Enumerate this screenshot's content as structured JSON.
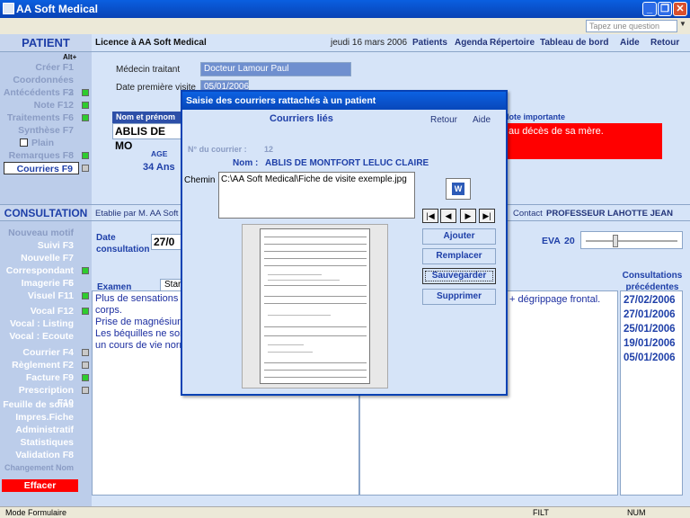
{
  "window": {
    "title": "AA Soft Medical"
  },
  "menu": {
    "question_placeholder": "Tapez une question"
  },
  "header": {
    "patient_section": "PATIENT",
    "licence": "Licence à  AA Soft Medical",
    "date": "jeudi 16 mars 2006",
    "nav": [
      "Patients",
      "Agenda",
      "Répertoire",
      "Tableau de bord",
      "Aide",
      "Retour"
    ]
  },
  "sidebar": {
    "alt_hint": "Alt+",
    "patient_items": [
      {
        "label": "Créer",
        "key": "F1",
        "state": "dis"
      },
      {
        "label": "Coordonnées",
        "key": "F2",
        "state": "dis"
      },
      {
        "label": "Antécédents",
        "key": "F3",
        "state": "dis",
        "sq": "green"
      },
      {
        "label": "Note",
        "key": "F12",
        "state": "dis",
        "sq": "green"
      },
      {
        "label": "Traitements",
        "key": "F6",
        "state": "dis",
        "sq": "green"
      },
      {
        "label": "Synthèse",
        "key": "F7",
        "state": "dis"
      },
      {
        "label": "Plain",
        "key": "",
        "state": "dis"
      },
      {
        "label": "Remarques",
        "key": "F8",
        "state": "dis",
        "sq": "green"
      },
      {
        "label": "Courriers",
        "key": "F9",
        "state": "act",
        "sq": "gray"
      }
    ],
    "consultation_section": "CONSULTATION",
    "consult_items": [
      {
        "label": "Nouveau motif",
        "key": "",
        "state": "dis"
      },
      {
        "label": "Suivi",
        "key": "F3",
        "state": "white"
      },
      {
        "label": "Nouvelle",
        "key": "F7",
        "state": "white"
      },
      {
        "label": "Correspondant",
        "key": "F5",
        "state": "white",
        "sq": "green"
      },
      {
        "label": "Imagerie",
        "key": "F6",
        "state": "white"
      },
      {
        "label": "Visuel",
        "key": "F11",
        "state": "white",
        "sq": "green"
      },
      {
        "label": "Vocal",
        "key": "F12",
        "state": "white",
        "sq": "green"
      },
      {
        "label": "Vocal : Listing",
        "key": "",
        "state": "white"
      },
      {
        "label": "Vocal : Ecoute",
        "key": "",
        "state": "white"
      },
      {
        "label": "Courrier",
        "key": "F4",
        "state": "white",
        "sq": "gray"
      },
      {
        "label": "Règlement",
        "key": "F2",
        "state": "white",
        "sq": "gray"
      },
      {
        "label": "Facture",
        "key": "F9",
        "state": "white",
        "sq": "green"
      },
      {
        "label": "Prescription",
        "key": "F10",
        "state": "white",
        "sq": "gray"
      },
      {
        "label": "Feuille de soins",
        "key": "",
        "state": "white"
      },
      {
        "label": "Impres.Fiche",
        "key": "",
        "state": "white"
      },
      {
        "label": "Administratif",
        "key": "",
        "state": "white"
      },
      {
        "label": "Statistiques",
        "key": "",
        "state": "white"
      },
      {
        "label": "Validation",
        "key": "F8",
        "state": "white"
      },
      {
        "label": "Changement Nom",
        "key": "",
        "state": "dis"
      }
    ],
    "effacer": "Effacer"
  },
  "patient": {
    "medecin_label": "Médecin traitant",
    "medecin_value": "Docteur Lamour Paul",
    "first_visit_label": "Date première visite",
    "first_visit_value": "05/01/2006",
    "nom_label": "Nom et prénom",
    "nom_value": "ABLIS DE MO",
    "age_label": "AGE",
    "age_value": "34 Ans",
    "note_label": "Note importante",
    "note_value": "au décès de sa mère.",
    "etablie_par": "Etablie par M. AA Soft",
    "contact_label": "Contact",
    "contact_value": "PROFESSEUR LAHOTTE JEAN"
  },
  "consultation": {
    "date_label": "Date consultation",
    "date_value": "27/0",
    "eva_label": "EVA",
    "eva_value": "20",
    "eva_level": 0.2,
    "examen_tab": "Examen",
    "examen_tab2": "Star",
    "notes_lines": [
      "Plus de sensations",
      "corps.",
      "Prise de magnésiun",
      "Les béquilles ne sor",
      "un cours de vie norr"
    ],
    "notes_right": "+ dégrippage frontal.",
    "prev_title": "Consultations précédentes",
    "prev_dates": [
      "27/02/2006",
      "27/01/2006",
      "25/01/2006",
      "19/01/2006",
      "05/01/2006"
    ]
  },
  "dialog": {
    "title": "Saisie des courriers rattachés à un patient",
    "heading": "Courriers liés",
    "retour": "Retour",
    "aide": "Aide",
    "num_label": "N° du courrier :",
    "num_value": "12",
    "nom_label": "Nom :",
    "nom_value": "ABLIS DE MONTFORT LELUC CLAIRE",
    "chemin_label": "Chemin",
    "chemin_value": "C:\\AA Soft Medical\\Fiche de visite exemple.jpg",
    "buttons": [
      "Ajouter",
      "Remplacer",
      "Sauvegarder",
      "Supprimer"
    ]
  },
  "statusbar": {
    "mode": "Mode Formulaire",
    "filt": "FILT",
    "num": "NUM"
  }
}
